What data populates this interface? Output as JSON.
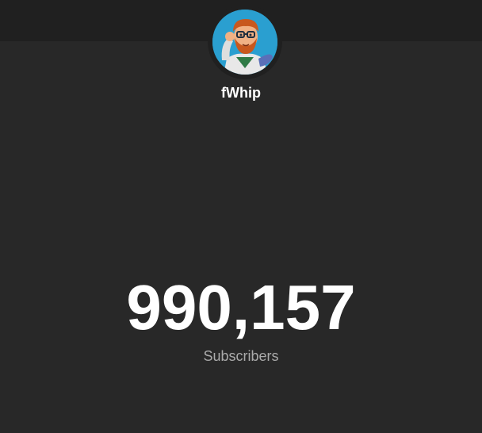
{
  "channel": {
    "name": "fWhip",
    "avatar_icon": "cartoon-avatar-icon"
  },
  "stats": {
    "subscriber_count": "990,157",
    "subscriber_label": "Subscribers"
  },
  "colors": {
    "background": "#282828",
    "top_bar": "#202020",
    "avatar_background": "#2a9fd0",
    "count_text": "#ffffff",
    "label_text": "#aaaaaa"
  }
}
